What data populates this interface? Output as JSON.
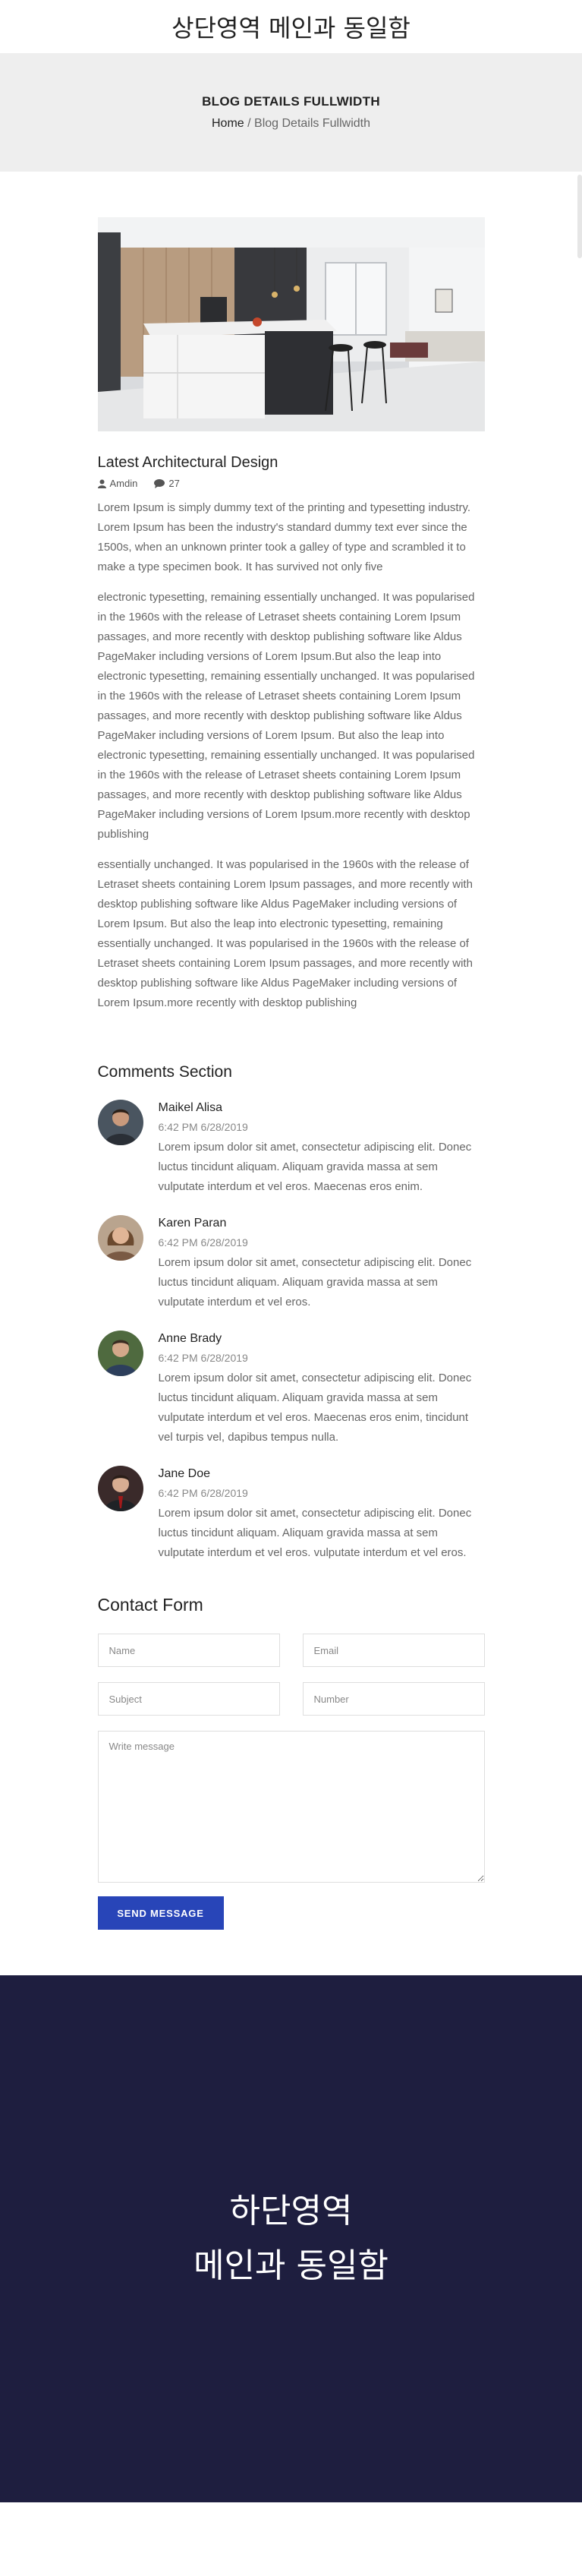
{
  "header": {
    "title": "상단영역 메인과 동일함"
  },
  "banner": {
    "title": "BLOG DETAILS FULLWIDTH",
    "breadcrumb_home": "Home",
    "breadcrumb_separator": " / ",
    "breadcrumb_current": "Blog Details Fullwidth"
  },
  "post": {
    "image_icon": "kitchen-interior-photo",
    "title": "Latest Architectural Design",
    "author": "Amdin",
    "comments_count": "27",
    "paragraphs": [
      "Lorem Ipsum is simply dummy text of the printing and typesetting industry. Lorem Ipsum has been the industry's standard dummy text ever since the 1500s, when an unknown printer took a galley of type and scrambled it to make a type specimen book. It has survived not only five",
      "electronic typesetting, remaining essentially unchanged. It was popularised in the 1960s with the release of Letraset sheets containing Lorem Ipsum passages, and more recently with desktop publishing software like Aldus PageMaker including versions of Lorem Ipsum.But also the leap into electronic typesetting, remaining essentially unchanged. It was popularised in the 1960s with the release of Letraset sheets containing Lorem Ipsum passages, and more recently with desktop publishing software like Aldus PageMaker including versions of Lorem Ipsum. But also the leap into electronic typesetting, remaining essentially unchanged. It was popularised in the 1960s with the release of Letraset sheets containing Lorem Ipsum passages, and more recently with desktop publishing software like Aldus PageMaker including versions of Lorem Ipsum.more recently with desktop publishing",
      "essentially unchanged. It was popularised in the 1960s with the release of Letraset sheets containing Lorem Ipsum passages, and more recently with desktop publishing software like Aldus PageMaker including versions of Lorem Ipsum. But also the leap into electronic typesetting, remaining essentially unchanged. It was popularised in the 1960s with the release of Letraset sheets containing Lorem Ipsum passages, and more recently with desktop publishing software like Aldus PageMaker including versions of Lorem Ipsum.more recently with desktop publishing"
    ]
  },
  "comments": {
    "title": "Comments Section",
    "items": [
      {
        "name": "Maikel Alisa",
        "date": "6:42 PM 6/28/2019",
        "text": "Lorem ipsum dolor sit amet, consectetur adipiscing elit. Donec luctus tincidunt aliquam. Aliquam gravida massa at sem vulputate interdum et vel eros. Maecenas eros enim."
      },
      {
        "name": "Karen Paran",
        "date": "6:42 PM 6/28/2019",
        "text": "Lorem ipsum dolor sit amet, consectetur adipiscing elit. Donec luctus tincidunt aliquam. Aliquam gravida massa at sem vulputate interdum et vel eros."
      },
      {
        "name": "Anne Brady",
        "date": "6:42 PM 6/28/2019",
        "text": "Lorem ipsum dolor sit amet, consectetur adipiscing elit. Donec luctus tincidunt aliquam. Aliquam gravida massa at sem vulputate interdum et vel eros. Maecenas eros enim, tincidunt vel turpis vel, dapibus tempus nulla."
      },
      {
        "name": "Jane Doe",
        "date": "6:42 PM 6/28/2019",
        "text": "Lorem ipsum dolor sit amet, consectetur adipiscing elit. Donec luctus tincidunt aliquam. Aliquam gravida massa at sem vulputate interdum et vel eros. vulputate interdum et vel eros."
      }
    ]
  },
  "contact": {
    "title": "Contact Form",
    "name_placeholder": "Name",
    "email_placeholder": "Email",
    "subject_placeholder": "Subject",
    "number_placeholder": "Number",
    "message_placeholder": "Write message",
    "send_label": "SEND MESSAGE"
  },
  "footer": {
    "line1": "하단영역",
    "line2": "메인과 동일함"
  },
  "colors": {
    "accent": "#2845b8",
    "footer_bg": "#1e1e3f",
    "banner_bg": "#eeeeee"
  }
}
